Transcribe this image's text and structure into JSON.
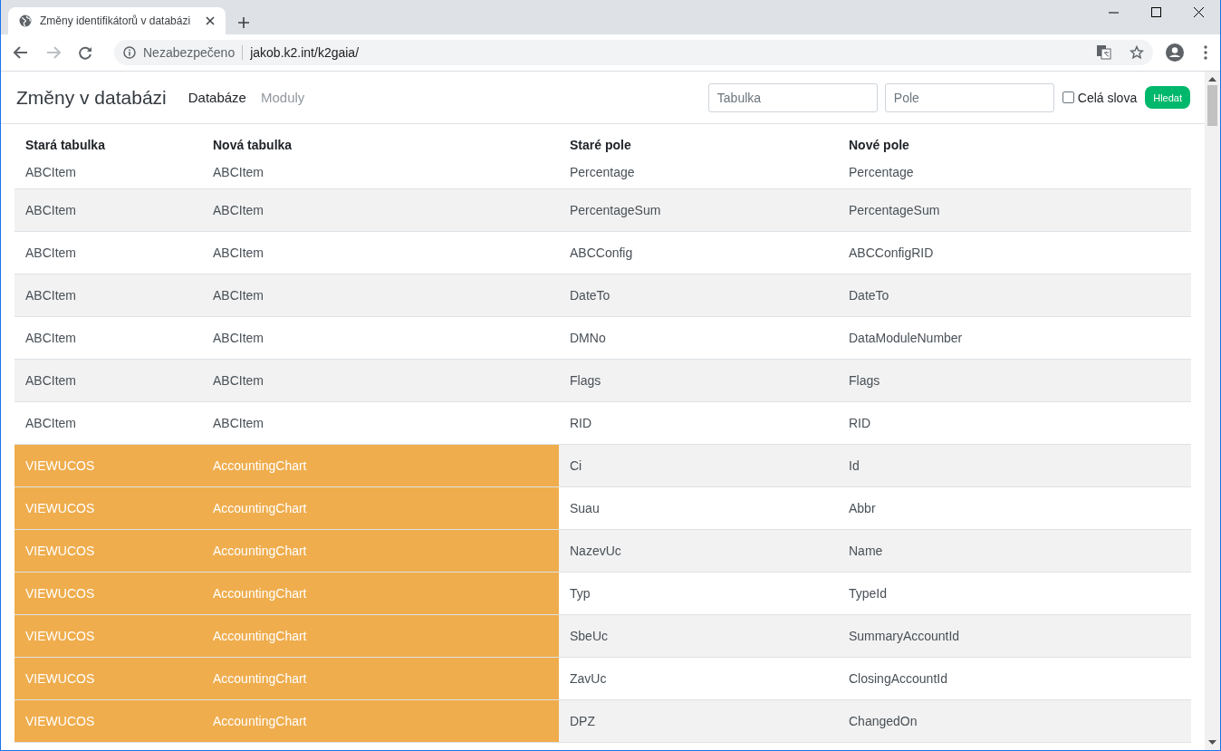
{
  "browser": {
    "tab_title": "Změny identifikátorů v databázi",
    "security_label": "Nezabezpečeno",
    "url": "jakob.k2.int/k2gaia/"
  },
  "app": {
    "title": "Změny v databázi",
    "nav": [
      {
        "label": "Databáze",
        "selected": true
      },
      {
        "label": "Moduly",
        "selected": false
      }
    ],
    "table_filter": {
      "placeholder": "Tabulka"
    },
    "field_filter": {
      "placeholder": "Pole"
    },
    "whole_words": {
      "label": "Celá slova",
      "checked": false
    },
    "search_button": "Hledat"
  },
  "table": {
    "columns": [
      "Stará tabulka",
      "Nová tabulka",
      "Staré pole",
      "Nové pole"
    ],
    "rows": [
      {
        "cells": [
          "ABCItem",
          "ABCItem",
          "Percentage",
          "Percentage"
        ],
        "highlighted": false,
        "partial": true
      },
      {
        "cells": [
          "ABCItem",
          "ABCItem",
          "PercentageSum",
          "PercentageSum"
        ],
        "highlighted": false
      },
      {
        "cells": [
          "ABCItem",
          "ABCItem",
          "ABCConfig",
          "ABCConfigRID"
        ],
        "highlighted": false
      },
      {
        "cells": [
          "ABCItem",
          "ABCItem",
          "DateTo",
          "DateTo"
        ],
        "highlighted": false
      },
      {
        "cells": [
          "ABCItem",
          "ABCItem",
          "DMNo",
          "DataModuleNumber"
        ],
        "highlighted": false
      },
      {
        "cells": [
          "ABCItem",
          "ABCItem",
          "Flags",
          "Flags"
        ],
        "highlighted": false
      },
      {
        "cells": [
          "ABCItem",
          "ABCItem",
          "RID",
          "RID"
        ],
        "highlighted": false
      },
      {
        "cells": [
          "VIEWUCOS",
          "AccountingChart",
          "Ci",
          "Id"
        ],
        "highlighted": true
      },
      {
        "cells": [
          "VIEWUCOS",
          "AccountingChart",
          "Suau",
          "Abbr"
        ],
        "highlighted": true
      },
      {
        "cells": [
          "VIEWUCOS",
          "AccountingChart",
          "NazevUc",
          "Name"
        ],
        "highlighted": true
      },
      {
        "cells": [
          "VIEWUCOS",
          "AccountingChart",
          "Typ",
          "TypeId"
        ],
        "highlighted": true
      },
      {
        "cells": [
          "VIEWUCOS",
          "AccountingChart",
          "SbeUc",
          "SummaryAccountId"
        ],
        "highlighted": true
      },
      {
        "cells": [
          "VIEWUCOS",
          "AccountingChart",
          "ZavUc",
          "ClosingAccountId"
        ],
        "highlighted": true
      },
      {
        "cells": [
          "VIEWUCOS",
          "AccountingChart",
          "DPZ",
          "ChangedOn"
        ],
        "highlighted": true
      }
    ]
  }
}
